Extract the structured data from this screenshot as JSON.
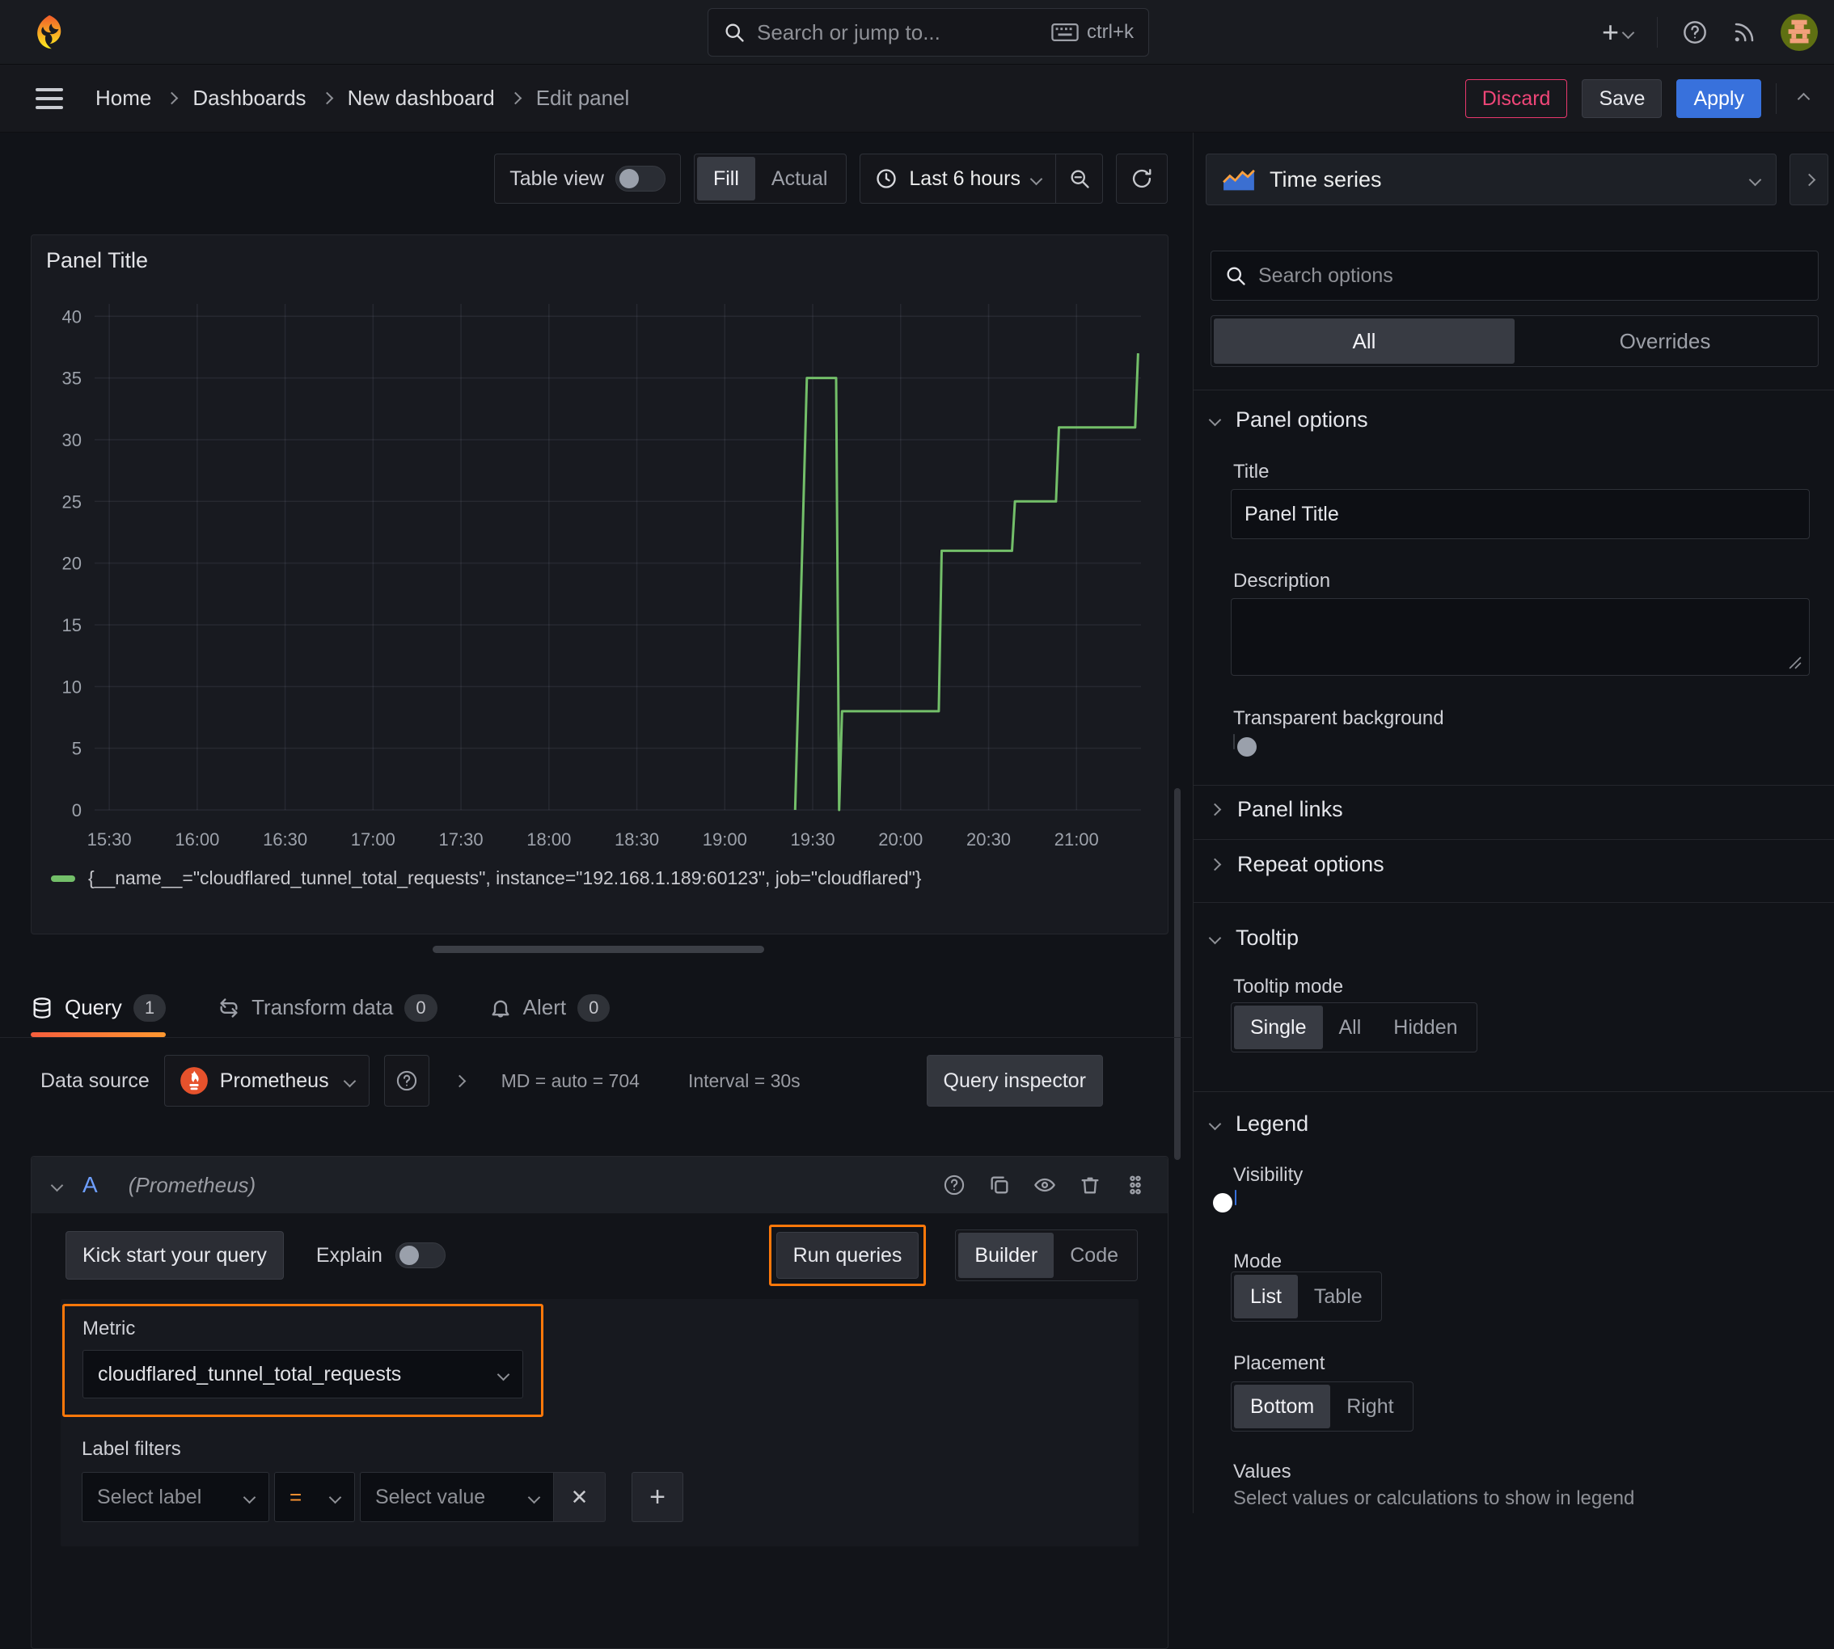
{
  "topbar": {
    "search_placeholder": "Search or jump to...",
    "search_shortcut": "ctrl+k"
  },
  "breadcrumb": {
    "items": [
      "Home",
      "Dashboards",
      "New dashboard",
      "Edit panel"
    ]
  },
  "header_actions": {
    "discard": "Discard",
    "save": "Save",
    "apply": "Apply"
  },
  "view_toolbar": {
    "table_view": "Table view",
    "fill": "Fill",
    "actual": "Actual",
    "time_range": "Last 6 hours"
  },
  "panel": {
    "title": "Panel Title"
  },
  "chart_data": {
    "type": "line",
    "line_style": "step",
    "title": "Panel Title",
    "grid": true,
    "legend_position": "bottom",
    "x_ticks": [
      "15:30",
      "16:00",
      "16:30",
      "17:00",
      "17:30",
      "18:00",
      "18:30",
      "19:00",
      "19:30",
      "20:00",
      "20:30",
      "21:00"
    ],
    "x_range_minutes": [
      925,
      1282
    ],
    "y_ticks": [
      0,
      5,
      10,
      15,
      20,
      25,
      30,
      35,
      40
    ],
    "ylim": [
      0,
      41
    ],
    "series": [
      {
        "name": "{__name__=\"cloudflared_tunnel_total_requests\", instance=\"192.168.1.189:60123\", job=\"cloudflared\"}",
        "color": "#73bf69",
        "points": [
          {
            "t": "19:24",
            "v": 0
          },
          {
            "t": "19:28",
            "v": 35
          },
          {
            "t": "19:38",
            "v": 35
          },
          {
            "t": "19:39",
            "v": 0
          },
          {
            "t": "19:40",
            "v": 8
          },
          {
            "t": "20:13",
            "v": 8
          },
          {
            "t": "20:14",
            "v": 21
          },
          {
            "t": "20:38",
            "v": 21
          },
          {
            "t": "20:39",
            "v": 25
          },
          {
            "t": "20:53",
            "v": 25
          },
          {
            "t": "20:54",
            "v": 31
          },
          {
            "t": "21:20",
            "v": 31
          },
          {
            "t": "21:21",
            "v": 37
          }
        ]
      }
    ]
  },
  "query_tabs": {
    "query": "Query",
    "query_badge": "1",
    "transform": "Transform data",
    "transform_badge": "0",
    "alert": "Alert",
    "alert_badge": "0"
  },
  "datasource_bar": {
    "label": "Data source",
    "value": "Prometheus",
    "max_data_points": "MD = auto = 704",
    "interval": "Interval = 30s",
    "query_inspector": "Query inspector"
  },
  "query_row": {
    "ref_id": "A",
    "datasource_hint": "(Prometheus)",
    "kick_start": "Kick start your query",
    "explain": "Explain",
    "run_queries": "Run queries",
    "builder": "Builder",
    "code": "Code",
    "metric_label": "Metric",
    "metric_value": "cloudflared_tunnel_total_requests",
    "label_filters": "Label filters",
    "select_label": "Select label",
    "operator": "=",
    "select_value": "Select value"
  },
  "icons": {
    "plus": "+",
    "close": "✕",
    "add": "+"
  },
  "viz_picker": {
    "value": "Time series"
  },
  "options_pane": {
    "search_placeholder": "Search options",
    "tabs": {
      "all": "All",
      "overrides": "Overrides"
    },
    "panel_options": {
      "header": "Panel options",
      "title_label": "Title",
      "title_value": "Panel Title",
      "description_label": "Description",
      "transparent_label": "Transparent background",
      "panel_links": "Panel links",
      "repeat_options": "Repeat options"
    },
    "tooltip": {
      "header": "Tooltip",
      "mode_label": "Tooltip mode",
      "single": "Single",
      "all": "All",
      "hidden": "Hidden"
    },
    "legend": {
      "header": "Legend",
      "visibility_label": "Visibility",
      "mode_label": "Mode",
      "list": "List",
      "table": "Table",
      "placement_label": "Placement",
      "bottom": "Bottom",
      "right": "Right",
      "values_label": "Values",
      "values_hint": "Select values or calculations to show in legend"
    }
  },
  "colors": {
    "highlight_orange": "#ff780a",
    "series_green": "#73bf69",
    "apply_blue": "#3871dc",
    "discard_pink": "#e8386d"
  }
}
